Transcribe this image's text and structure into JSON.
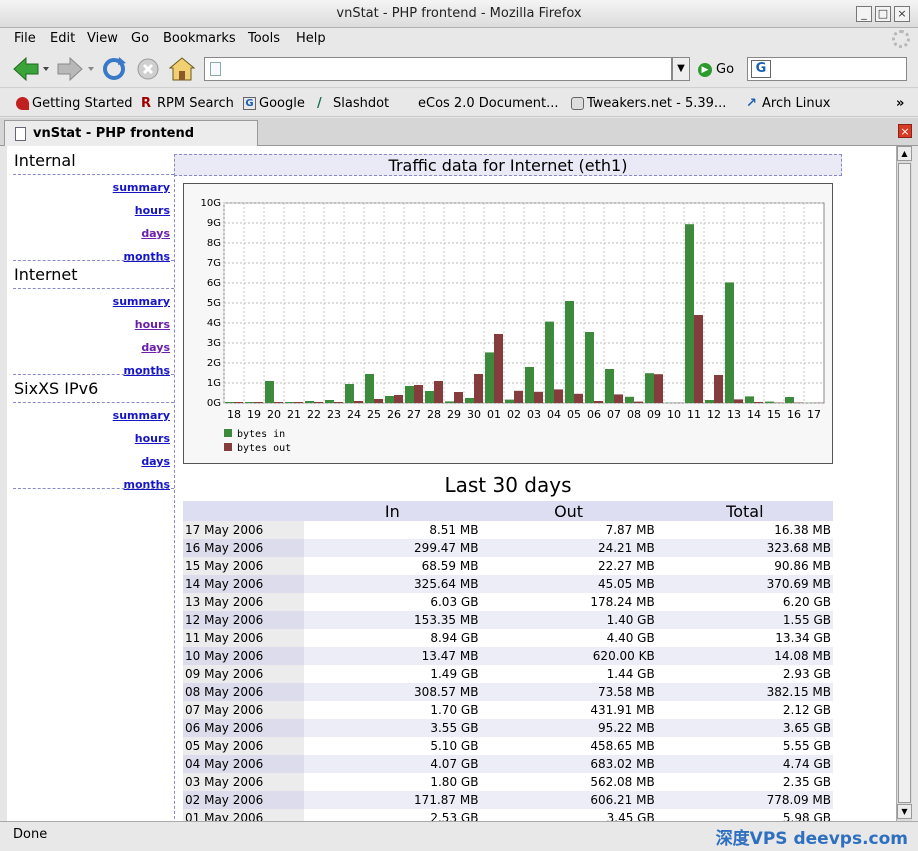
{
  "window": {
    "title": "vnStat - PHP frontend - Mozilla Firefox"
  },
  "menu": [
    "File",
    "Edit",
    "View",
    "Go",
    "Bookmarks",
    "Tools",
    "Help"
  ],
  "nav": {
    "go_label": "Go"
  },
  "bookmarks": [
    "Getting Started",
    "RPM Search",
    "Google",
    "Slashdot",
    "eCos 2.0 Document...",
    "Tweakers.net - 5.39...",
    "Arch Linux"
  ],
  "tab": {
    "title": "vnStat - PHP frontend"
  },
  "status": {
    "text": "Done",
    "watermark": "深度VPS deevps.com"
  },
  "sidebar": [
    {
      "title": "Internal",
      "links": [
        "summary",
        "hours",
        "days",
        "months"
      ],
      "visited": [
        false,
        false,
        true,
        false
      ]
    },
    {
      "title": "Internet",
      "links": [
        "summary",
        "hours",
        "days",
        "months"
      ],
      "visited": [
        false,
        true,
        true,
        false
      ]
    },
    {
      "title": "SixXS IPv6",
      "links": [
        "summary",
        "hours",
        "days",
        "months"
      ],
      "visited": [
        false,
        false,
        false,
        false
      ]
    }
  ],
  "main": {
    "title": "Traffic data for Internet (eth1)",
    "table_title": "Last 30 days"
  },
  "table": {
    "headers": [
      "",
      "In",
      "Out",
      "Total"
    ],
    "rows": [
      [
        "17 May 2006",
        "8.51 MB",
        "7.87 MB",
        "16.38 MB"
      ],
      [
        "16 May 2006",
        "299.47 MB",
        "24.21 MB",
        "323.68 MB"
      ],
      [
        "15 May 2006",
        "68.59 MB",
        "22.27 MB",
        "90.86 MB"
      ],
      [
        "14 May 2006",
        "325.64 MB",
        "45.05 MB",
        "370.69 MB"
      ],
      [
        "13 May 2006",
        "6.03 GB",
        "178.24 MB",
        "6.20 GB"
      ],
      [
        "12 May 2006",
        "153.35 MB",
        "1.40 GB",
        "1.55 GB"
      ],
      [
        "11 May 2006",
        "8.94 GB",
        "4.40 GB",
        "13.34 GB"
      ],
      [
        "10 May 2006",
        "13.47 MB",
        "620.00 KB",
        "14.08 MB"
      ],
      [
        "09 May 2006",
        "1.49 GB",
        "1.44 GB",
        "2.93 GB"
      ],
      [
        "08 May 2006",
        "308.57 MB",
        "73.58 MB",
        "382.15 MB"
      ],
      [
        "07 May 2006",
        "1.70 GB",
        "431.91 MB",
        "2.12 GB"
      ],
      [
        "06 May 2006",
        "3.55 GB",
        "95.22 MB",
        "3.65 GB"
      ],
      [
        "05 May 2006",
        "5.10 GB",
        "458.65 MB",
        "5.55 GB"
      ],
      [
        "04 May 2006",
        "4.07 GB",
        "683.02 MB",
        "4.74 GB"
      ],
      [
        "03 May 2006",
        "1.80 GB",
        "562.08 MB",
        "2.35 GB"
      ],
      [
        "02 May 2006",
        "171.87 MB",
        "606.21 MB",
        "778.09 MB"
      ],
      [
        "01 May 2006",
        "2.53 GB",
        "3.45 GB",
        "5.98 GB"
      ]
    ]
  },
  "chart_data": {
    "type": "bar",
    "categories": [
      "18",
      "19",
      "20",
      "21",
      "22",
      "23",
      "24",
      "25",
      "26",
      "27",
      "28",
      "29",
      "30",
      "01",
      "02",
      "03",
      "04",
      "05",
      "06",
      "07",
      "08",
      "09",
      "10",
      "11",
      "12",
      "13",
      "14",
      "15",
      "16",
      "17"
    ],
    "series": [
      {
        "name": "bytes in",
        "color": "#3d8a3d",
        "values": [
          0.05,
          0.05,
          1.1,
          0.05,
          0.1,
          0.15,
          0.95,
          1.45,
          0.35,
          0.85,
          0.6,
          0.08,
          0.25,
          2.53,
          0.17,
          1.8,
          4.07,
          5.1,
          3.55,
          1.7,
          0.31,
          1.49,
          0.01,
          8.94,
          0.15,
          6.03,
          0.33,
          0.07,
          0.3,
          0.01
        ]
      },
      {
        "name": "bytes out",
        "color": "#843c3c",
        "values": [
          0.05,
          0.05,
          0.05,
          0.05,
          0.05,
          0.05,
          0.1,
          0.2,
          0.4,
          0.9,
          1.1,
          0.55,
          1.45,
          3.45,
          0.61,
          0.56,
          0.68,
          0.46,
          0.1,
          0.43,
          0.07,
          1.44,
          0.01,
          4.4,
          1.4,
          0.18,
          0.05,
          0.02,
          0.02,
          0.01
        ]
      }
    ],
    "yticks": [
      "0G",
      "1G",
      "2G",
      "3G",
      "4G",
      "5G",
      "6G",
      "7G",
      "8G",
      "9G",
      "10G"
    ],
    "ylim": [
      0,
      10
    ],
    "grid": true,
    "legend": "bottom-left"
  }
}
